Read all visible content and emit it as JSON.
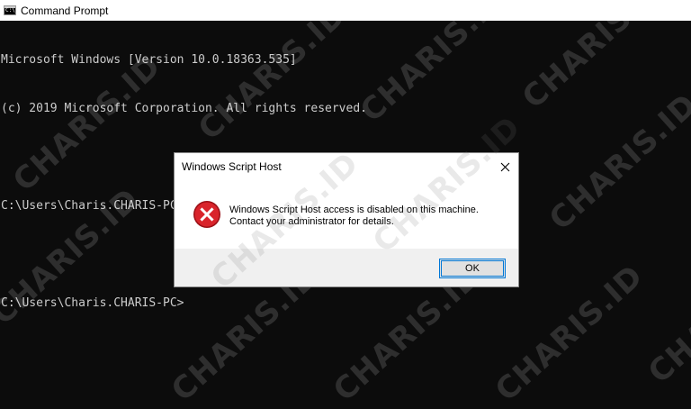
{
  "window": {
    "title": "Command Prompt",
    "icon": "cmd-icon",
    "icon_glyph": "C:\\"
  },
  "console": {
    "lines": [
      "Microsoft Windows [Version 10.0.18363.535]",
      "(c) 2019 Microsoft Corporation. All rights reserved.",
      "",
      "C:\\Users\\Charis.CHARIS-PC>slmgr/xpr",
      "",
      "C:\\Users\\Charis.CHARIS-PC>"
    ]
  },
  "dialog": {
    "title": "Windows Script Host",
    "close_icon": "close-icon",
    "icon": "error-icon",
    "message_line1": "Windows Script Host access is disabled on this machine.",
    "message_line2": "Contact your administrator for details.",
    "ok_label": "OK"
  },
  "watermark": {
    "text": "CHARIS.ID"
  },
  "colors": {
    "console_bg": "#0c0c0c",
    "console_text": "#cccccc",
    "error_red": "#d9242b",
    "focus_blue": "#0078d7"
  }
}
